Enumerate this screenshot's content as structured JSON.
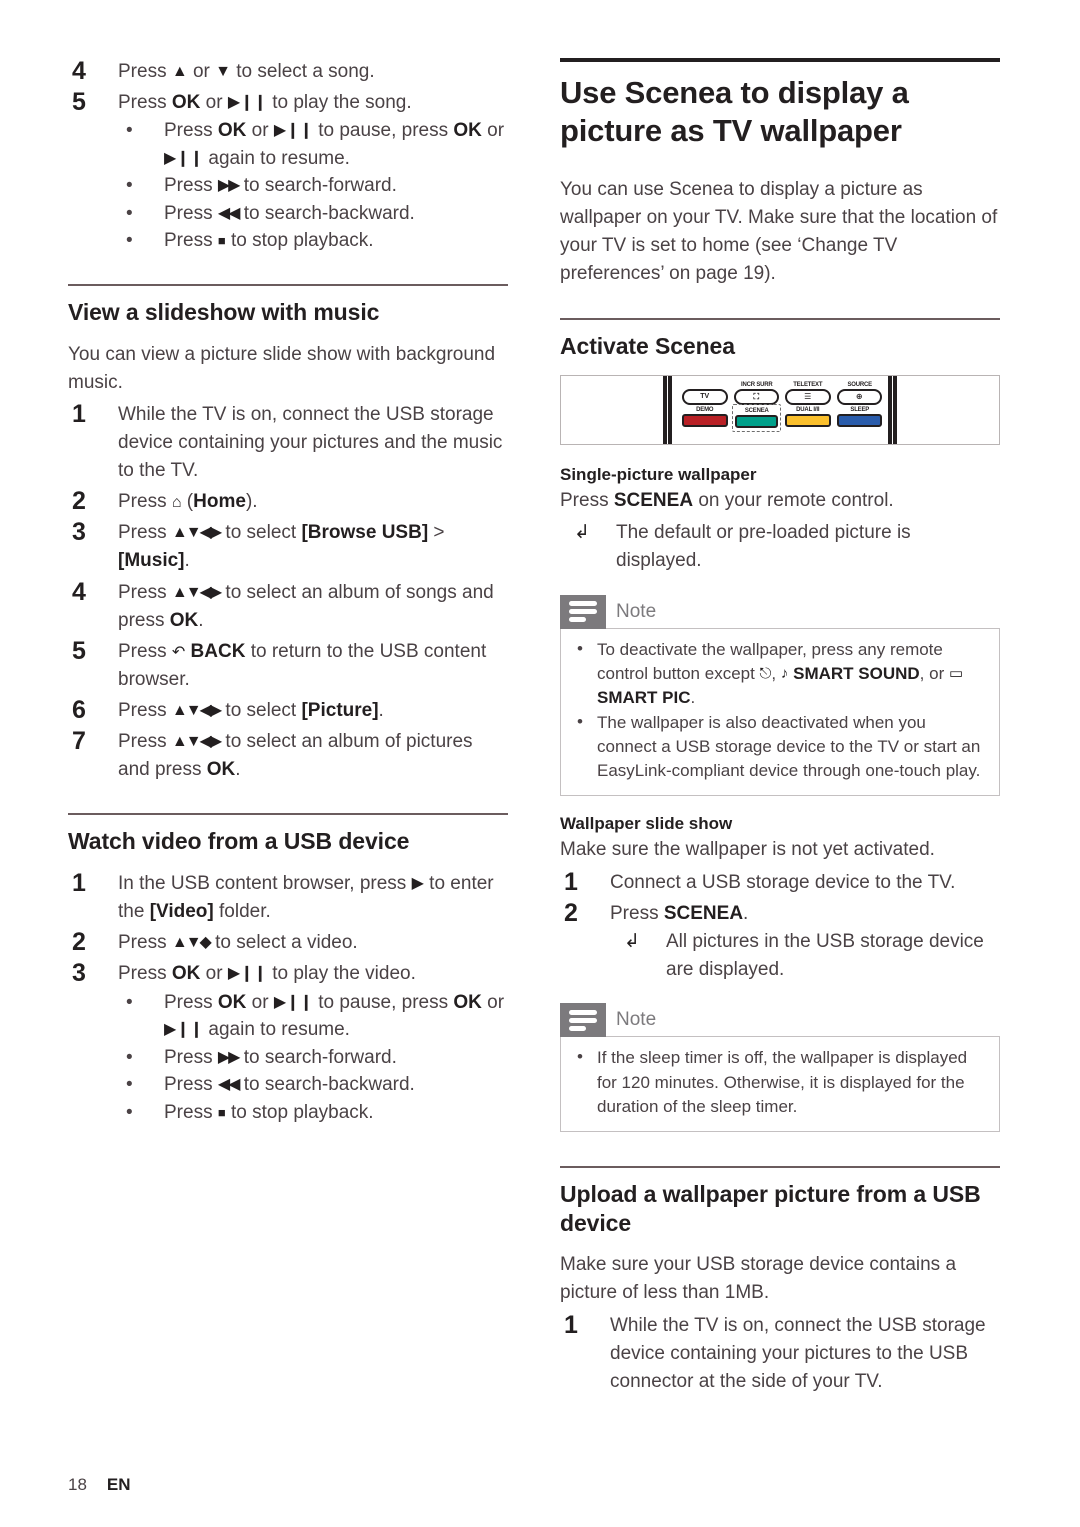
{
  "footer": {
    "page_number": "18",
    "language": "EN"
  },
  "left_column": {
    "continued_steps": [
      {
        "num": "4",
        "text_before": "Press ",
        "sym": "▲ or ▼",
        "text_after": " to select a song."
      }
    ],
    "step4_full": "Press ▲ or ▼ to select a song.",
    "step5_lead": "Press OK or ▶❙❙ to play the song.",
    "playback_bullets": [
      "Press OK or ▶❙❙ to pause, press OK or ▶❙❙ again to resume.",
      "Press ▶▶ to search-forward.",
      "Press ◀◀ to search-backward.",
      "Press ■ to stop playback."
    ],
    "slideshow": {
      "heading": "View a slideshow with music",
      "intro": "You can view a picture slide show with background music.",
      "steps": [
        "While the TV is on, connect the USB storage device containing your pictures and the music to the TV.",
        "Press ⌂ (Home).",
        "Press ▲▼◀▶ to select [Browse USB] > [Music].",
        "Press ▲▼◀▶ to select an album of songs and press OK.",
        "Press ↺ BACK to return to the USB content browser.",
        "Press ▲▼◀▶ to select [Picture].",
        "Press ▲▼◀▶ to select an album of pictures and press OK."
      ]
    },
    "watch_video": {
      "heading": "Watch video from a USB device",
      "steps": [
        "In the USB content browser, press ▶ to enter the [Video] folder.",
        "Press ▲▼◆ to select a video.",
        "Press OK or ▶❙❙ to play the video."
      ],
      "bullets": [
        "Press OK or ▶❙❙ to pause, press OK or ▶❙❙ again to resume.",
        "Press ▶▶ to search-forward.",
        "Press ◀◀ to search-backward.",
        "Press ■ to stop playback."
      ]
    }
  },
  "right_column": {
    "title": "Use Scenea to display a picture as TV wallpaper",
    "intro": "You can use Scenea to display a picture as wallpaper on your TV. Make sure that the location of your TV is set to home (see ‘Change TV preferences’ on page 19).",
    "activate": {
      "heading": "Activate Scenea",
      "remote": {
        "top_row": [
          {
            "label": "",
            "key": "TV",
            "type": "text"
          },
          {
            "label": "INCR SURR",
            "key": "incr-surr",
            "type": "icon"
          },
          {
            "label": "TELETEXT",
            "key": "teletext",
            "type": "icon"
          },
          {
            "label": "SOURCE",
            "key": "source",
            "type": "icon"
          }
        ],
        "bottom_row": [
          {
            "label": "DEMO",
            "color": "#b92025",
            "highlighted": false
          },
          {
            "label": "SCENEA",
            "color": "#00a08a",
            "highlighted": true
          },
          {
            "label": "DUAL I/II",
            "color": "#fbc02d",
            "highlighted": false
          },
          {
            "label": "SLEEP",
            "color": "#2a5cab",
            "highlighted": false
          }
        ]
      },
      "single_picture": {
        "heading": "Single-picture wallpaper",
        "line": "Press SCENEA on your remote control.",
        "press_word": "Press ",
        "bold_word": "SCENEA",
        "rest_word": " on your remote control.",
        "result": "The default or pre-loaded picture is displayed."
      },
      "note1": {
        "label": "Note",
        "bullets": [
          "To deactivate the wallpaper, press any remote control button except ⏻, ♪ SMART SOUND, or ▭ SMART PIC.",
          "The wallpaper is also deactivated when you connect a USB storage device to the TV or start an EasyLink-compliant device through one-touch play."
        ]
      },
      "slide_show": {
        "heading": "Wallpaper slide show",
        "intro": "Make sure the wallpaper is not yet activated.",
        "steps": [
          "Connect a USB storage device to the TV.",
          "Press SCENEA."
        ],
        "result": "All pictures in the USB storage device are displayed."
      },
      "note2": {
        "label": "Note",
        "bullets": [
          "If the sleep timer is off, the wallpaper is displayed for 120 minutes. Otherwise, it is displayed for the duration of the sleep timer."
        ]
      }
    },
    "upload": {
      "heading": "Upload a wallpaper picture from a USB device",
      "intro": "Make sure your USB storage device contains a picture of less than 1MB.",
      "steps": [
        "While the TV is on, connect the USB storage device containing your pictures to the USB connector at the side of your TV."
      ]
    }
  }
}
